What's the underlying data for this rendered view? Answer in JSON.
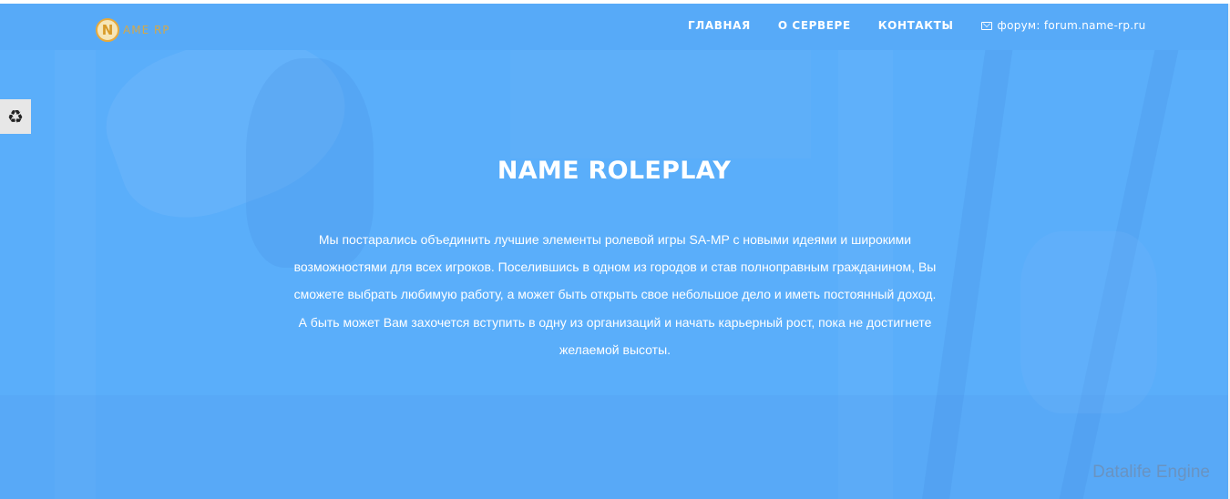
{
  "header": {
    "logo": {
      "badge_letter": "N",
      "text": "AME RP"
    },
    "nav": [
      {
        "label": "ГЛАВНАЯ"
      },
      {
        "label": "О СЕРВЕРЕ"
      },
      {
        "label": "КОНТАКТЫ"
      }
    ],
    "forum": {
      "icon": "envelope-icon",
      "label": "форум: forum.name-rp.ru"
    }
  },
  "side_widget": {
    "icon": "recycle-icon",
    "glyph": "♻"
  },
  "hero": {
    "title": "NAME ROLEPLAY",
    "lines": [
      "Мы постарались объединить лучшие элементы ролевой игры SA-MP с новыми идеями и широкими",
      "возможностями для всех игроков. Поселившись в одном из городов и став полноправным гражданином, Вы",
      "сможете выбрать любимую работу, а может быть открыть свое небольшое дело и иметь постоянный доход.",
      "А быть может Вам захочется вступить в одну из организаций и начать карьерный рост, пока не достигнете",
      "желаемой высоты."
    ]
  },
  "watermark": "Datalife Engine",
  "colors": {
    "hero_background": "#5aaefa",
    "navbar_background": "#57aaf8",
    "logo_accent": "#e8a93a",
    "text": "#ffffff"
  }
}
